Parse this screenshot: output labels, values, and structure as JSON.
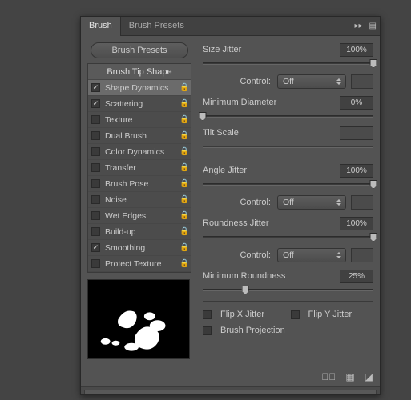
{
  "tabs": {
    "brush": "Brush",
    "presets": "Brush Presets"
  },
  "buttons": {
    "presets": "Brush Presets"
  },
  "settings": {
    "header": "Brush Tip Shape",
    "items": [
      {
        "label": "Shape Dynamics",
        "checked": true,
        "selected": true,
        "lock": true
      },
      {
        "label": "Scattering",
        "checked": true,
        "lock": true
      },
      {
        "label": "Texture",
        "checked": false,
        "lock": true
      },
      {
        "label": "Dual Brush",
        "checked": false,
        "lock": true
      },
      {
        "label": "Color Dynamics",
        "checked": false,
        "lock": true
      },
      {
        "label": "Transfer",
        "checked": false,
        "lock": true
      },
      {
        "label": "Brush Pose",
        "checked": false,
        "lock": true
      },
      {
        "label": "Noise",
        "checked": false,
        "lock": true
      },
      {
        "label": "Wet Edges",
        "checked": false,
        "lock": true
      },
      {
        "label": "Build-up",
        "checked": false,
        "lock": true
      },
      {
        "label": "Smoothing",
        "checked": true,
        "lock": true
      },
      {
        "label": "Protect Texture",
        "checked": false,
        "lock": true
      }
    ]
  },
  "controls": {
    "sizeJitter": {
      "label": "Size Jitter",
      "value": "100%",
      "pos": 100
    },
    "control": {
      "label": "Control:",
      "value": "Off"
    },
    "minDiam": {
      "label": "Minimum Diameter",
      "value": "0%",
      "pos": 0
    },
    "tiltScale": {
      "label": "Tilt Scale",
      "value": "",
      "pos": null
    },
    "angleJitter": {
      "label": "Angle Jitter",
      "value": "100%",
      "pos": 100
    },
    "roundJitter": {
      "label": "Roundness Jitter",
      "value": "100%",
      "pos": 100
    },
    "minRound": {
      "label": "Minimum Roundness",
      "value": "25%",
      "pos": 25
    },
    "flipX": "Flip X Jitter",
    "flipY": "Flip Y Jitter",
    "brushProj": "Brush Projection"
  }
}
